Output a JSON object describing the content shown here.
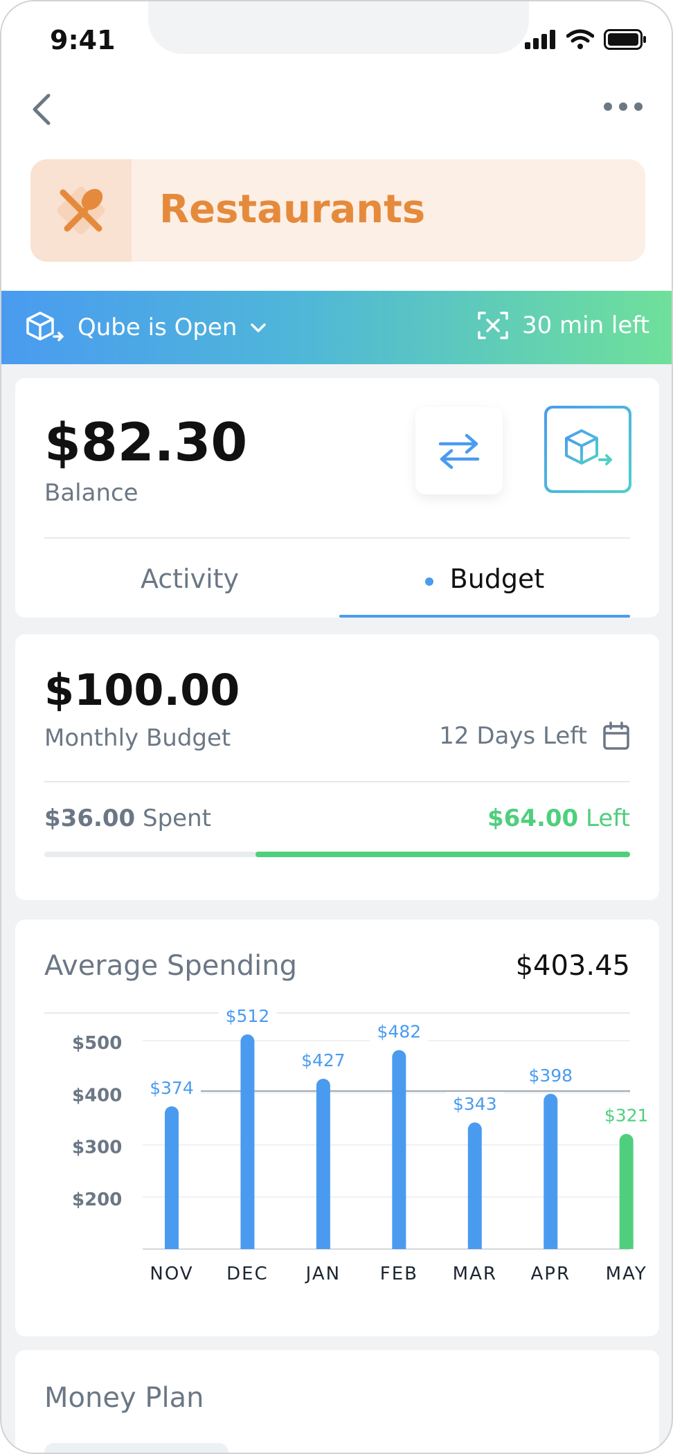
{
  "status_bar": {
    "time": "9:41"
  },
  "header": {
    "category_title": "Restaurants"
  },
  "qube_bar": {
    "status_label": "Qube is Open",
    "time_left": "30 min left"
  },
  "balance": {
    "amount": "$82.30",
    "label": "Balance"
  },
  "tabs": [
    {
      "label": "Activity",
      "active": false
    },
    {
      "label": "Budget",
      "active": true
    }
  ],
  "budget": {
    "amount": "$100.00",
    "label": "Monthly Budget",
    "days_left": "12 Days Left",
    "spent_amount": "$36.00",
    "spent_suffix": "Spent",
    "left_amount": "$64.00",
    "left_suffix": "Left",
    "left_fraction": 0.64
  },
  "average_spending": {
    "title": "Average Spending",
    "value": "$403.45"
  },
  "chart_data": {
    "type": "bar",
    "categories": [
      "NOV",
      "DEC",
      "JAN",
      "FEB",
      "MAR",
      "APR",
      "MAY"
    ],
    "values": [
      374,
      512,
      427,
      482,
      343,
      398,
      321
    ],
    "value_labels": [
      "$374",
      "$512",
      "$427",
      "$482",
      "$343",
      "$398",
      "$321"
    ],
    "y_ticks": [
      200,
      300,
      400,
      500
    ],
    "y_tick_labels": [
      "$200",
      "$300",
      "$400",
      "$500"
    ],
    "ylim": [
      100,
      520
    ],
    "average_line": 403.45,
    "colors": {
      "bar": "#4a9bf0",
      "highlight": "#4fcf7d",
      "label": "#4a9bf0",
      "highlight_label": "#4fcf7d"
    }
  },
  "money_plan": {
    "title": "Money Plan"
  },
  "colors": {
    "accent": "#4a9bf0",
    "brand_orange": "#e58a3c",
    "success": "#4fcf7d"
  }
}
